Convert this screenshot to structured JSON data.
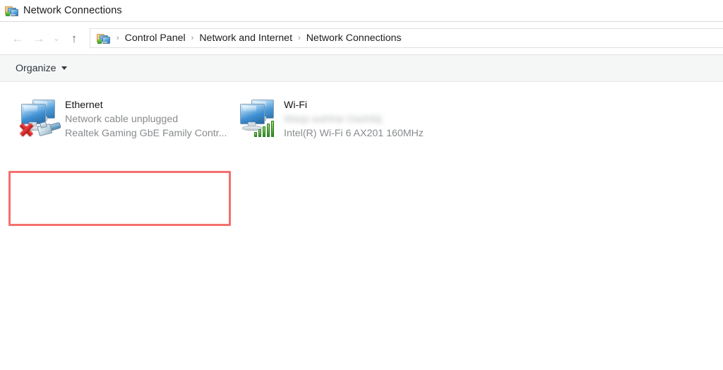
{
  "window": {
    "title": "Network Connections",
    "icon": "network-connections-icon"
  },
  "navigation": {
    "back_icon": "←",
    "forward_icon": "→",
    "recent_icon": "⌄",
    "up_icon": "↑",
    "breadcrumb": {
      "icon": "network-connections-icon",
      "separator": "›",
      "items": [
        {
          "label": "Control Panel"
        },
        {
          "label": "Network and Internet"
        },
        {
          "label": "Network Connections"
        }
      ]
    }
  },
  "toolbar": {
    "organize_label": "Organize",
    "organize_caret": "▾"
  },
  "connections": [
    {
      "name": "Ethernet",
      "status": "Network cable unplugged",
      "adapter": "Realtek Gaming GbE Family Contr...",
      "icon": "ethernet-adapter-icon",
      "badge": "red-x-error-icon",
      "highlighted": true,
      "redacted": false
    },
    {
      "name": "Wi-Fi",
      "status": "Wasp wahhar Dashfdj",
      "adapter": "Intel(R) Wi-Fi 6 AX201 160MHz",
      "icon": "wifi-adapter-icon",
      "badge": "green-signal-bars-icon",
      "highlighted": false,
      "redacted": true
    }
  ],
  "colors": {
    "annotation": "#f4706d",
    "toolbar_bg": "#f5f7f7",
    "status_text": "#888b8e"
  }
}
